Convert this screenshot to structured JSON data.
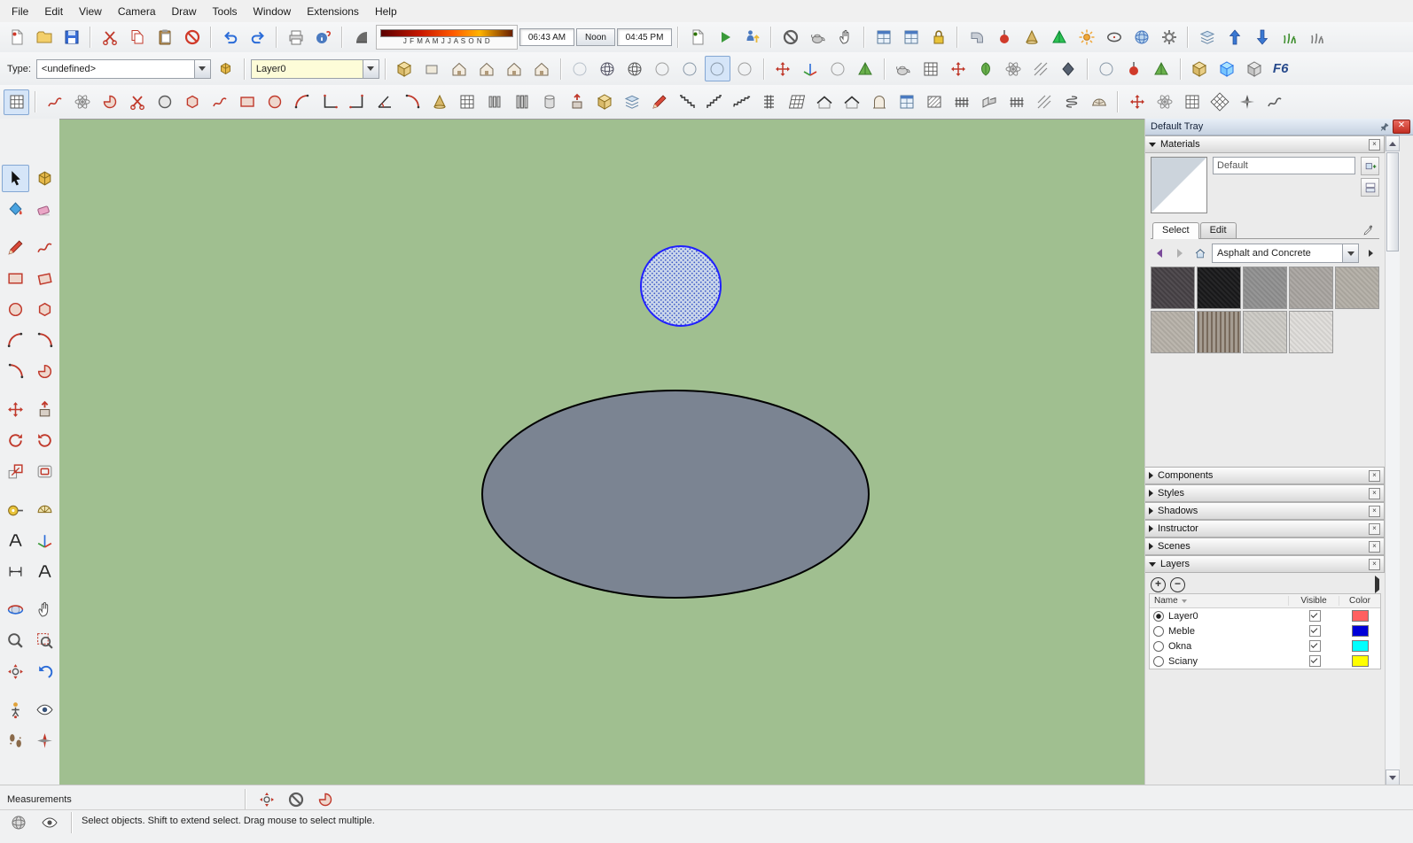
{
  "menu": {
    "items": [
      "File",
      "Edit",
      "View",
      "Camera",
      "Draw",
      "Tools",
      "Window",
      "Extensions",
      "Help"
    ]
  },
  "toolbar1": {
    "shadow": {
      "months": "J F M A M J J A S O N D",
      "time_start": "06:43 AM",
      "time_mid": "Noon",
      "time_end": "04:45 PM"
    }
  },
  "toolbar2": {
    "type_label": "Type:",
    "type_value": "<undefined>",
    "layer_value": "Layer0",
    "fredo_logo": "F6"
  },
  "canvas": {
    "background": "#a0bf90",
    "ellipse_fill": "#7b8492",
    "ellipse_stroke": "#000000",
    "circle_stroke": "#2020ff",
    "circle_fill": "#cbd7ea",
    "selection_dot_color": "#3c58c8"
  },
  "tray": {
    "title": "Default Tray",
    "materials": {
      "title": "Materials",
      "current_name": "Default",
      "tab_select": "Select",
      "tab_edit": "Edit",
      "collection": "Asphalt and Concrete",
      "swatches": [
        "#474246",
        "#19191b",
        "#909090",
        "#a9a5a0",
        "#b3aea6",
        "#b7b1a9",
        "#998e82",
        "#cccac5",
        "#dfddda"
      ]
    },
    "sections": [
      {
        "label": "Components"
      },
      {
        "label": "Styles"
      },
      {
        "label": "Shadows"
      },
      {
        "label": "Instructor"
      },
      {
        "label": "Scenes"
      }
    ],
    "layers": {
      "title": "Layers",
      "col_name": "Name",
      "col_visible": "Visible",
      "col_color": "Color",
      "rows": [
        {
          "name": "Layer0",
          "color": "#ff6060"
        },
        {
          "name": "Meble",
          "color": "#0000d8"
        },
        {
          "name": "Okna",
          "color": "#00ffff"
        },
        {
          "name": "Sciany",
          "color": "#ffff00"
        }
      ]
    }
  },
  "measurements": {
    "label": "Measurements"
  },
  "status": {
    "hint": "Select objects. Shift to extend select. Drag mouse to select multiple."
  }
}
